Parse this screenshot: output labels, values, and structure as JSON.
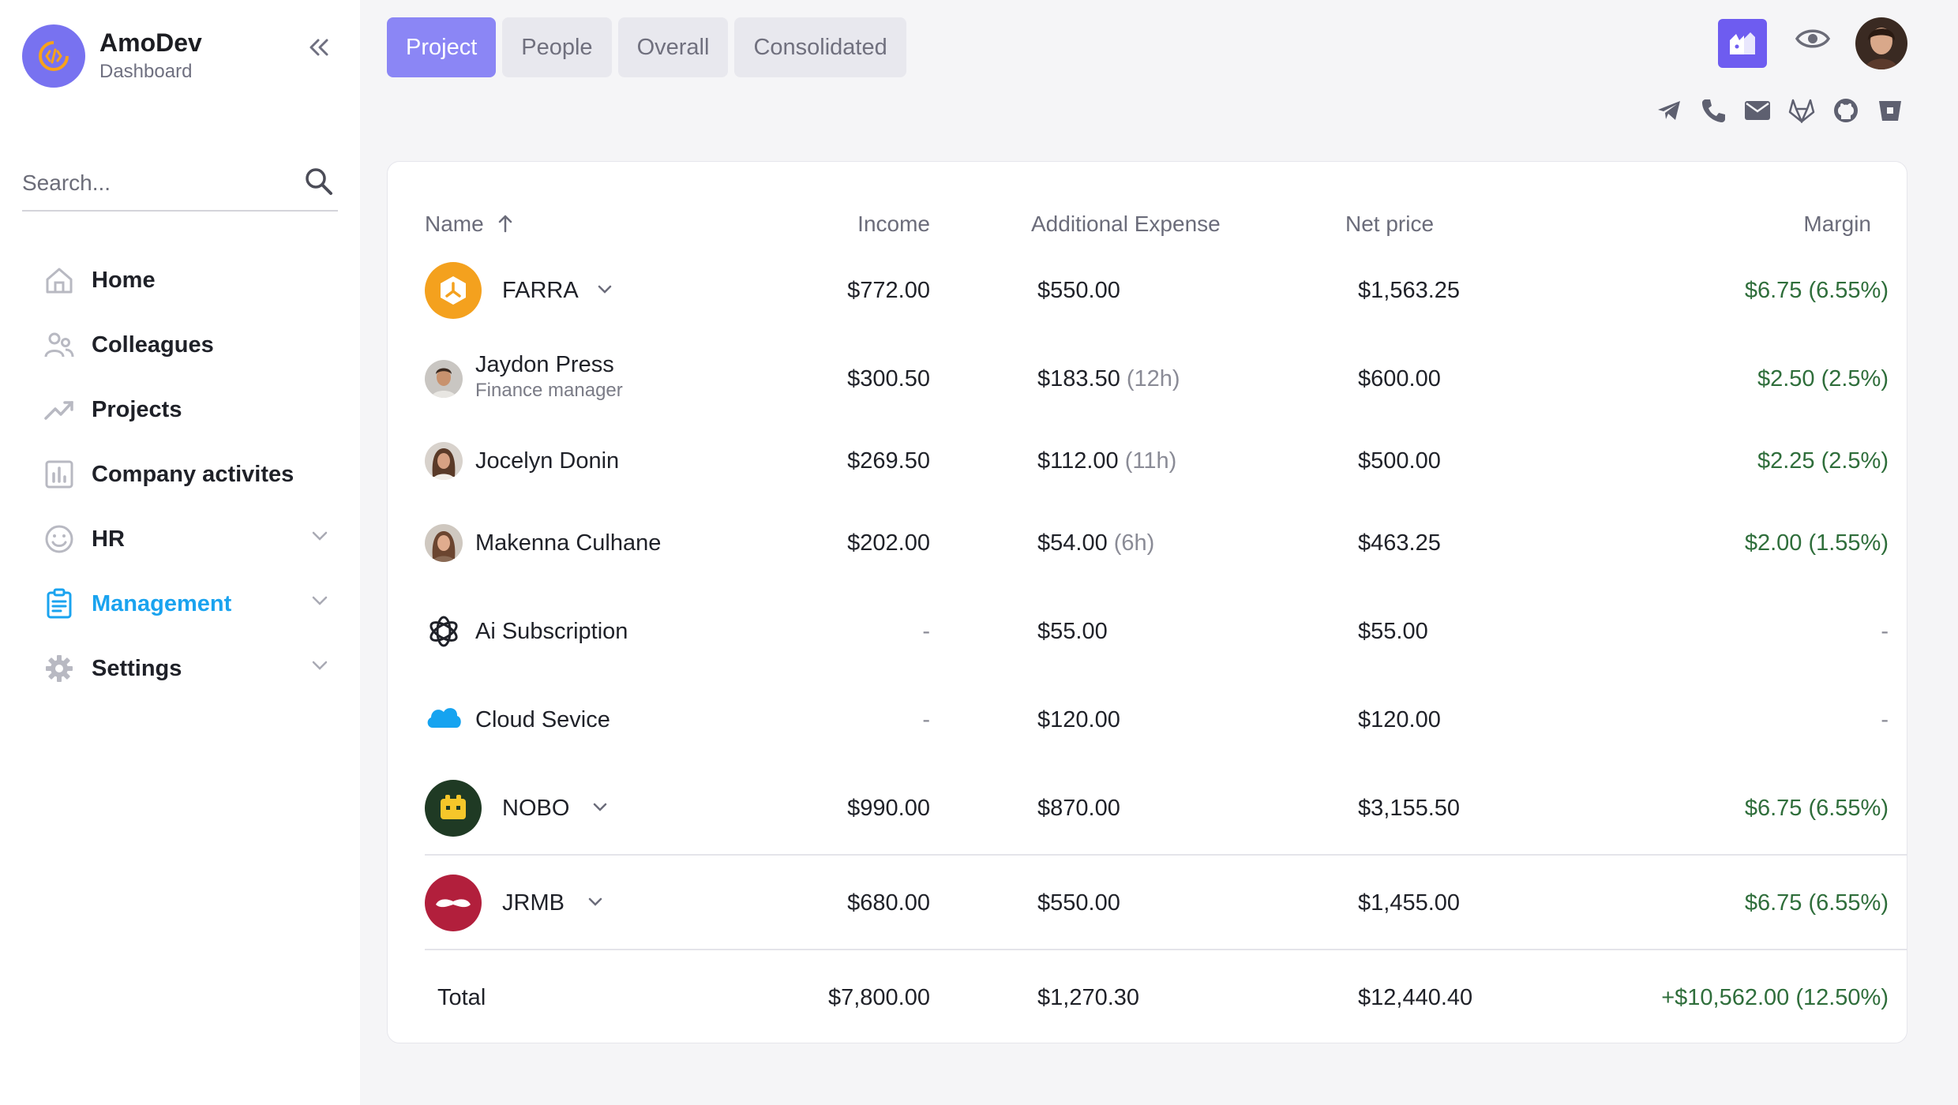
{
  "brand": {
    "name": "AmoDev",
    "subtitle": "Dashboard"
  },
  "search": {
    "placeholder": "Search..."
  },
  "nav": [
    {
      "label": "Home",
      "icon": "home-icon"
    },
    {
      "label": "Colleagues",
      "icon": "users-icon"
    },
    {
      "label": "Projects",
      "icon": "trending-up-icon"
    },
    {
      "label": "Company activites",
      "icon": "bar-chart-icon"
    },
    {
      "label": "HR",
      "icon": "smile-icon"
    },
    {
      "label": "Management",
      "icon": "clipboard-icon",
      "active": true
    },
    {
      "label": "Settings",
      "icon": "gear-icon"
    }
  ],
  "tabs": [
    "Project",
    "People",
    "Overall",
    "Consolidated"
  ],
  "active_tab": "Project",
  "colors": {
    "accent": "#8b86f5",
    "active_nav": "#1aa3ef",
    "positive": "#2f6e3b",
    "app_badge": "#6e5cf0"
  },
  "social_icons": [
    "telegram-icon",
    "phone-icon",
    "mail-icon",
    "gitlab-icon",
    "github-icon",
    "bitbucket-icon"
  ],
  "table": {
    "headers": {
      "name": "Name",
      "income": "Income",
      "expense": "Additional Expense",
      "net": "Net price",
      "margin": "Margin"
    },
    "rows": [
      {
        "name": "FARRA",
        "income": "$772.00",
        "expense": "$550.00",
        "hours": "",
        "net": "$1,563.25",
        "margin": "$6.75 (6.55%)"
      },
      {
        "name": "Jaydon Press",
        "role": "Finance manager",
        "income": "$300.50",
        "expense": "$183.50",
        "hours": "(12h)",
        "net": "$600.00",
        "margin": "$2.50 (2.5%)"
      },
      {
        "name": "Jocelyn Donin",
        "income": "$269.50",
        "expense": "$112.00",
        "hours": "(11h)",
        "net": "$500.00",
        "margin": "$2.25 (2.5%)"
      },
      {
        "name": "Makenna Culhane",
        "income": "$202.00",
        "expense": "$54.00",
        "hours": "(6h)",
        "net": "$463.25",
        "margin": "$2.00 (1.55%)"
      },
      {
        "name": "Ai Subscription",
        "income": "-",
        "expense": "$55.00",
        "hours": "",
        "net": "$55.00",
        "margin": "-"
      },
      {
        "name": "Cloud Sevice",
        "income": "-",
        "expense": "$120.00",
        "hours": "",
        "net": "$120.00",
        "margin": "-"
      },
      {
        "name": "NOBO",
        "income": "$990.00",
        "expense": "$870.00",
        "hours": "",
        "net": "$3,155.50",
        "margin": "$6.75 (6.55%)"
      },
      {
        "name": "JRMB",
        "income": "$680.00",
        "expense": "$550.00",
        "hours": "",
        "net": "$1,455.00",
        "margin": "$6.75 (6.55%)"
      }
    ],
    "total": {
      "label": "Total",
      "income": "$7,800.00",
      "expense": "$1,270.30",
      "net": "$12,440.40",
      "margin": "+$10,562.00 (12.50%)"
    }
  }
}
